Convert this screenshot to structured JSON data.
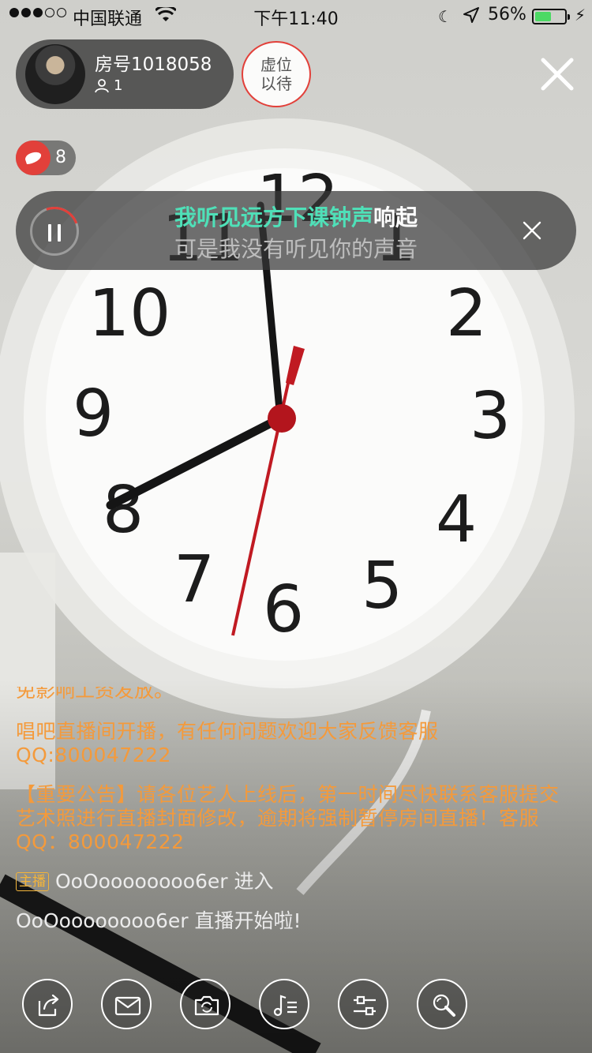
{
  "status_bar": {
    "carrier": "中国联通",
    "time": "下午11:40",
    "battery_percent": "56%",
    "battery_level": 0.56
  },
  "room": {
    "title": "房号1018058",
    "viewer_count": "1",
    "seat_button": [
      "虚位",
      "以待"
    ]
  },
  "likes": {
    "count": "8"
  },
  "music": {
    "lyric_sung": "我听见远方下课钟声",
    "lyric_rest": "响起",
    "lyric_next": "可是我没有听见你的声音"
  },
  "chat": {
    "cut_message": "免影响工资发放。",
    "messages": [
      {
        "type": "system",
        "text": "唱吧直播间开播，有任何问题欢迎大家反馈客服QQ:800047222"
      },
      {
        "type": "system",
        "text": "【重要公告】请各位艺人上线后，第一时间尽快联系客服提交艺术照进行直播封面修改，逾期将强制暂停房间直播！客服QQ：800047222"
      }
    ],
    "enter_tag": "主播",
    "enter_text": "OoOoooooooo6er 进入",
    "start_text": "OoOoooooooo6er 直播开始啦!"
  },
  "colors": {
    "accent_red": "#e2403a",
    "lyric_highlight": "#4fe0b8",
    "system_message": "#f49a3b",
    "host_tag": "#f3b43a"
  },
  "toolbar": {
    "icons": [
      "share-icon",
      "message-icon",
      "camera-flip-icon",
      "music-list-icon",
      "settings-sliders-icon",
      "magic-wand-icon"
    ]
  }
}
